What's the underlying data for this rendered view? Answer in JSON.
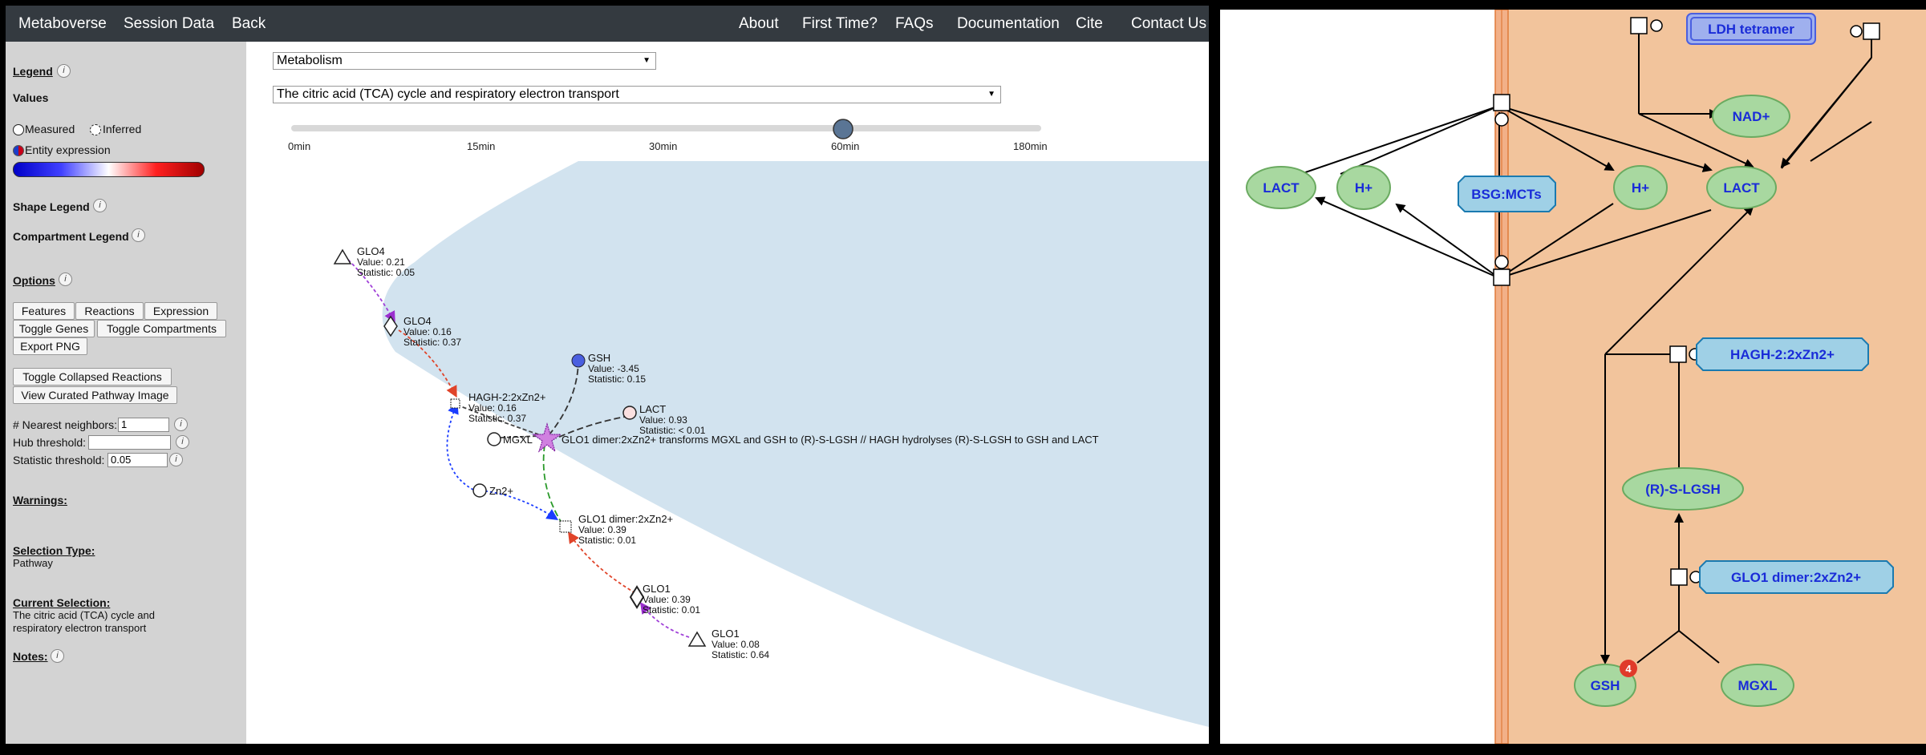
{
  "navbar": {
    "brand": "Metaboverse",
    "session_data": "Session Data",
    "back": "Back",
    "about": "About",
    "first_time": "First Time?",
    "faqs": "FAQs",
    "documentation": "Documentation",
    "cite": "Cite",
    "contact_us": "Contact Us"
  },
  "sidebar": {
    "legend": "Legend",
    "values": "Values",
    "measured": "Measured",
    "inferred": "Inferred",
    "entity_expression": "Entity expression",
    "shape_legend": "Shape Legend",
    "compartment_legend": "Compartment Legend",
    "options": "Options",
    "buttons": {
      "features": "Features",
      "reactions": "Reactions",
      "expression": "Expression",
      "toggle_genes": "Toggle Genes",
      "toggle_compartments": "Toggle Compartments",
      "export_png": "Export PNG",
      "toggle_collapsed_reactions": "Toggle Collapsed Reactions",
      "view_curated_pathway_image": "View Curated Pathway Image"
    },
    "nearest_neighbors_label": "# Nearest neighbors:",
    "nearest_neighbors_value": "1",
    "hub_threshold_label": "Hub threshold:",
    "hub_threshold_value": "",
    "statistic_threshold_label": "Statistic threshold:",
    "statistic_threshold_value": "0.05",
    "warnings": "Warnings:",
    "selection_type_label": "Selection Type:",
    "selection_type_value": "Pathway",
    "current_selection_label": "Current Selection:",
    "current_selection_line1": "The citric acid (TCA) cycle and",
    "current_selection_line2": "respiratory electron transport",
    "notes": "Notes:"
  },
  "controls": {
    "category_select": "Metabolism",
    "pathway_select": "The citric acid (TCA) cycle and respiratory electron transport",
    "timepoints": [
      "0min",
      "15min",
      "30min",
      "60min",
      "180min"
    ],
    "selected_timepoint_index": 3
  },
  "graph": {
    "nodes": {
      "glo4_gene": {
        "name": "GLO4",
        "value": "Value: 0.21",
        "stat": "Statistic: 0.05"
      },
      "glo4_protein": {
        "name": "GLO4",
        "value": "Value: 0.16",
        "stat": "Statistic: 0.37"
      },
      "hagh": {
        "name": "HAGH-2:2xZn2+",
        "value": "Value: 0.16",
        "stat": "Statistic: 0.37"
      },
      "gsh": {
        "name": "GSH",
        "value": "Value: -3.45",
        "stat": "Statistic: 0.15"
      },
      "lact": {
        "name": "LACT",
        "value": "Value: 0.93",
        "stat": "Statistic: < 0.01"
      },
      "mgxl": {
        "name": "MGXL"
      },
      "reaction": {
        "name": "GLO1 dimer:2xZn2+ transforms MGXL and GSH to (R)-S-LGSH // HAGH hydrolyses (R)-S-LGSH to GSH and LACT"
      },
      "zn": {
        "name": "Zn2+"
      },
      "glo1_dimer": {
        "name": "GLO1 dimer:2xZn2+",
        "value": "Value: 0.39",
        "stat": "Statistic: 0.01"
      },
      "glo1_protein": {
        "name": "GLO1",
        "value": "Value: 0.39",
        "stat": "Statistic: 0.01"
      },
      "glo1_gene": {
        "name": "GLO1",
        "value": "Value: 0.08",
        "stat": "Statistic: 0.64"
      }
    }
  },
  "curated": {
    "ldh_tetramer": "LDH tetramer",
    "nad": "NAD+",
    "lact_left": "LACT",
    "h_left": "H+",
    "bsg_mcts": "BSG:MCTs",
    "h_right": "H+",
    "lact_right": "LACT",
    "hagh": "HAGH-2:2xZn2+",
    "rslgsh": "(R)-S-LGSH",
    "glo1_dimer": "GLO1 dimer:2xZn2+",
    "gsh": "GSH",
    "gsh_badge": "4",
    "mgxl": "MGXL"
  },
  "colors": {
    "navbar": "#343a40",
    "sidebar": "#d3d3d3",
    "compartment": "#d2e3ef",
    "membrane": "#f2c49c",
    "metabolite_fill": "#a8d8a0",
    "protein_fill": "#9fd0e6"
  }
}
